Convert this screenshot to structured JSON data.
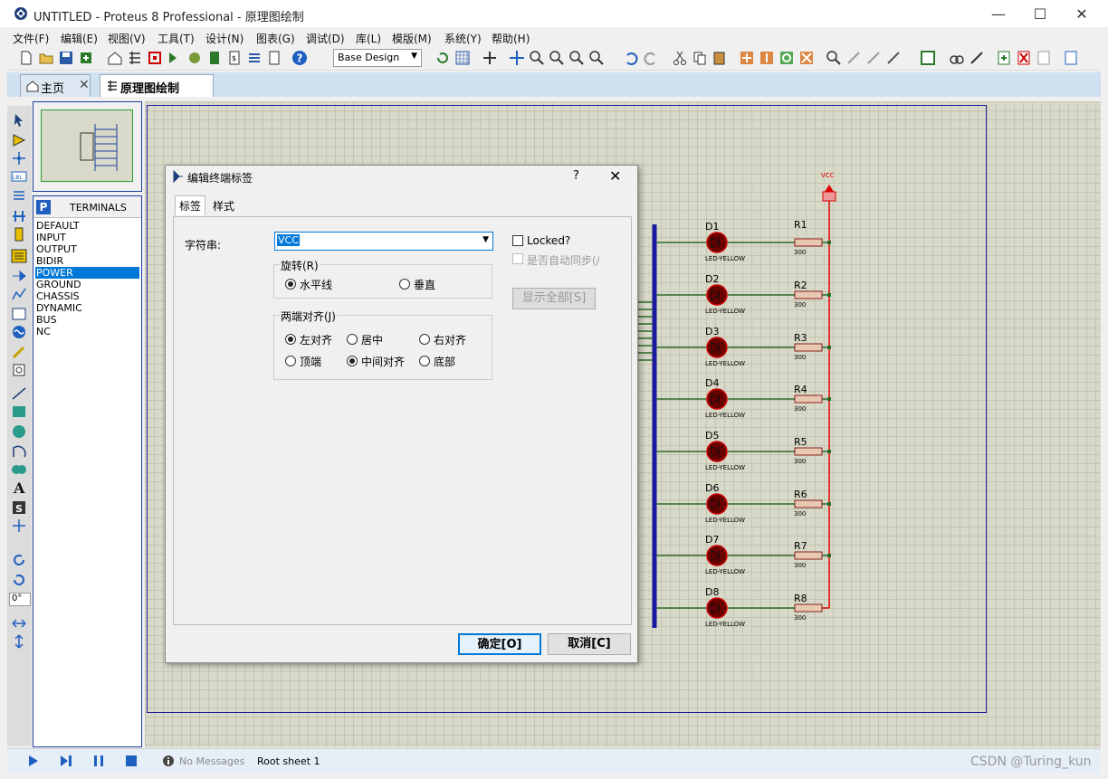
{
  "window": {
    "title": "UNTITLED - Proteus 8 Professional - 原理图绘制"
  },
  "menu": [
    "文件(F)",
    "编辑(E)",
    "视图(V)",
    "工具(T)",
    "设计(N)",
    "图表(G)",
    "调试(D)",
    "库(L)",
    "模版(M)",
    "系统(Y)",
    "帮助(H)"
  ],
  "toolbar": {
    "design_select": "Base Design"
  },
  "tabs": [
    {
      "label": "主页"
    },
    {
      "label": "原理图绘制"
    }
  ],
  "terminals": {
    "header_badge": "P",
    "title": "TERMINALS",
    "items": [
      "DEFAULT",
      "INPUT",
      "OUTPUT",
      "BIDIR",
      "POWER",
      "GROUND",
      "CHASSIS",
      "DYNAMIC",
      "BUS",
      "NC"
    ],
    "selected": "POWER"
  },
  "left_tools": {
    "rotation": "0°"
  },
  "schematic": {
    "power_label": "VCC",
    "leds": [
      "D1",
      "D2",
      "D3",
      "D4",
      "D5",
      "D6",
      "D7",
      "D8"
    ],
    "led_type": "LED-YELLOW",
    "resistors": [
      "R1",
      "R2",
      "R3",
      "R4",
      "R5",
      "R6",
      "R7",
      "R8"
    ],
    "resistor_value": "300"
  },
  "dialog": {
    "title": "编辑终端标签",
    "help": "?",
    "tabs": [
      "标签",
      "样式"
    ],
    "string_label": "字符串:",
    "string_value": "VCC",
    "locked_label": "Locked?",
    "autosync_label": "是否自动同步(/",
    "show_all_button": "显示全部[S]",
    "rotation_group": "旋转(R)",
    "rotation_options": [
      "水平线",
      "垂直"
    ],
    "rotation_selected": "水平线",
    "justify_group": "两端对齐(J)",
    "justify_options": [
      "左对齐",
      "居中",
      "右对齐",
      "顶端",
      "中间对齐",
      "底部"
    ],
    "justify_selected": [
      "左对齐",
      "中间对齐"
    ],
    "ok_button": "确定[O]",
    "cancel_button": "取消[C]"
  },
  "status": {
    "messages": "No Messages",
    "sheet": "Root sheet 1"
  },
  "watermark": "CSDN @Turing_kun"
}
